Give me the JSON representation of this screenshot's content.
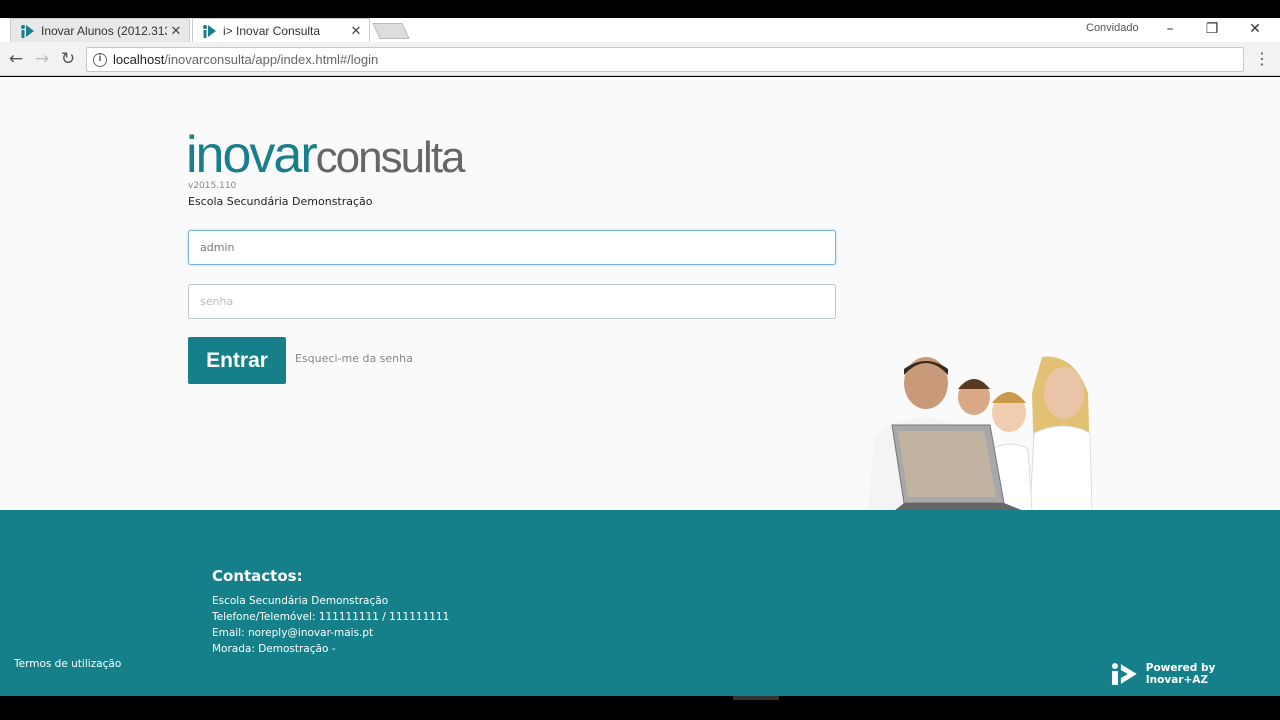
{
  "browser": {
    "tabs": [
      {
        "title": "Inovar Alunos (2012.313",
        "active": false
      },
      {
        "title": "i> Inovar Consulta",
        "active": true
      }
    ],
    "guest_label": "Convidado",
    "url_host": "localhost",
    "url_path": "/inovarconsulta/app/index.html#/login",
    "window_controls": {
      "minimize": "–",
      "restore": "❐",
      "close": "✕"
    }
  },
  "login": {
    "logo_part1": "inovar",
    "logo_part2": "consulta",
    "version": "v2015.110",
    "school": "Escola Secundária Demonstração",
    "username_value": "admin",
    "password_placeholder": "senha",
    "submit_label": "Entrar",
    "forgot_label": "Esqueci-me da senha"
  },
  "footer": {
    "title": "Contactos:",
    "lines": [
      "Escola Secundária Demonstração",
      "Telefone/Telemóvel: 111111111 / 111111111",
      "Email: noreply@inovar-mais.pt",
      "Morada: Demostração -"
    ],
    "terms": "Termos de utilização",
    "powered": "Powered by Inovar+AZ"
  },
  "colors": {
    "brand": "#15808a",
    "page_bg": "#fafafa"
  }
}
